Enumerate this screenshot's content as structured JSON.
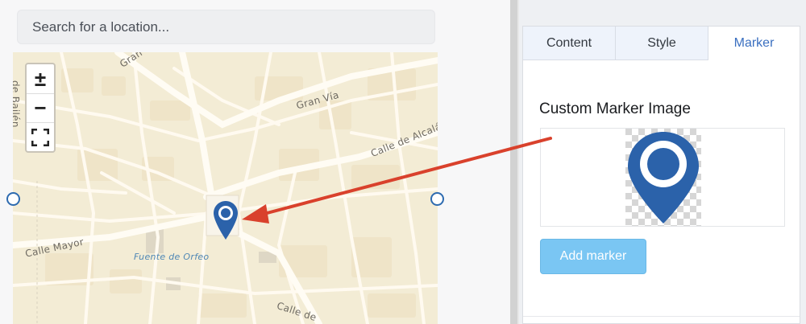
{
  "search": {
    "placeholder": "Search for a location..."
  },
  "map": {
    "zoom_in": "±",
    "zoom_out": "−",
    "fullscreen_icon": "fullscreen-icon",
    "labels": {
      "gran_via_1": "Gran Vía",
      "gran_via_2": "Gran Vía",
      "calle_alcala": "Calle de Alcalá",
      "calle_mayor": "Calle Mayor",
      "fuente_orfeo": "Fuente de Orfeo",
      "calle_de": "Calle de",
      "bailen": "de Bailén"
    },
    "marker_color": "#2b62aa"
  },
  "panel": {
    "tabs": [
      "Content",
      "Style",
      "Marker"
    ],
    "active_tab": "Marker",
    "section_title": "Custom Marker Image",
    "add_button": "Add marker"
  },
  "colors": {
    "accent": "#3a6fc0",
    "button": "#7ac6f3",
    "arrow": "#d9412c",
    "marker": "#2b62aa"
  }
}
